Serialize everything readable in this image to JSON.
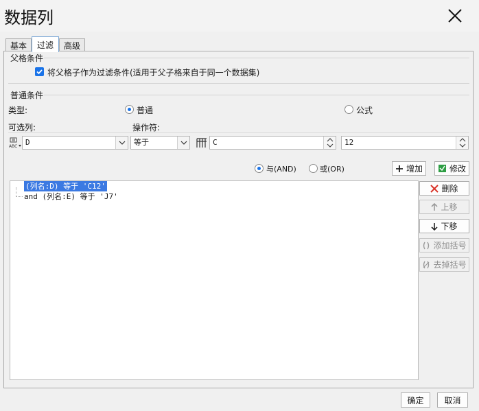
{
  "window": {
    "title": "数据列"
  },
  "tabs": [
    {
      "label": "基本"
    },
    {
      "label": "过滤"
    },
    {
      "label": "高级"
    }
  ],
  "parent_condition": {
    "section_title": "父格条件",
    "checkbox_label": "将父格子作为过滤条件(适用于父子格来自于同一个数据集)",
    "checked": true
  },
  "normal_condition": {
    "section_title": "普通条件",
    "type_label": "类型:",
    "type_options": [
      {
        "label": "普通",
        "selected": true
      },
      {
        "label": "公式",
        "selected": false
      }
    ],
    "column_label": "可选列:",
    "operator_label": "操作符:",
    "column_value": "D",
    "operator_value": "等于",
    "value_type": "C",
    "value": "12"
  },
  "logic": {
    "options": [
      {
        "label": "与(AND)",
        "selected": true
      },
      {
        "label": "或(OR)",
        "selected": false
      }
    ],
    "add_label": "增加",
    "modify_label": "修改"
  },
  "conditions": [
    {
      "text": "(列名:D) 等于 'C12'",
      "selected": true
    },
    {
      "text": "and (列名:E) 等于 'J7'",
      "selected": false
    }
  ],
  "side_actions": {
    "delete_label": "删除",
    "up_label": "上移",
    "down_label": "下移",
    "add_bracket_label": "添加括号",
    "remove_bracket_label": "去掉括号"
  },
  "footer": {
    "ok_label": "确定",
    "cancel_label": "取消"
  },
  "colors": {
    "accent": "#1a73e8",
    "selection": "#3b79e2",
    "delete_icon": "#d93025",
    "modify_icon": "#2e9e44"
  }
}
